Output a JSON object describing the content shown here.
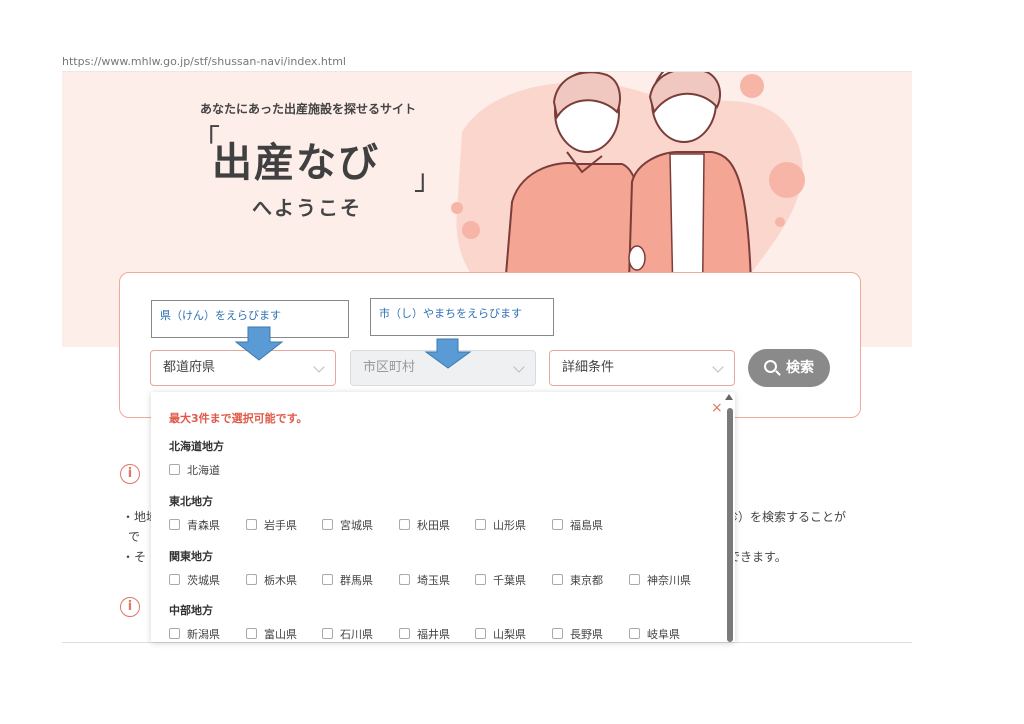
{
  "browser": {
    "url": "https://www.mhlw.go.jp/stf/shussan-navi/index.html"
  },
  "hero": {
    "tagline": "あなたにあった出産施設を探せるサイト",
    "bracket_open": "「",
    "brand": "出産なび",
    "bracket_close": "」",
    "welcome": "へようこそ"
  },
  "annotations": {
    "prefecture": "県（けん）をえらびます",
    "city": "市（し）やまちをえらびます"
  },
  "search": {
    "prefecture_placeholder": "都道府県",
    "city_placeholder": "市区町村",
    "conditions_placeholder": "詳細条件",
    "button_label": "検索"
  },
  "info": {
    "icon_glyph": "i",
    "line1_start": "・地域",
    "line1_end": "診）を検索することが",
    "line2_start": "で",
    "line2_end": "",
    "line3_start": "・そ",
    "line3_end": "できます。"
  },
  "dropdown": {
    "note": "最大3件まで選択可能です。",
    "close": "×",
    "regions": [
      {
        "name": "北海道地方",
        "prefectures": [
          "北海道"
        ]
      },
      {
        "name": "東北地方",
        "prefectures": [
          "青森県",
          "岩手県",
          "宮城県",
          "秋田県",
          "山形県",
          "福島県"
        ]
      },
      {
        "name": "関東地方",
        "prefectures": [
          "茨城県",
          "栃木県",
          "群馬県",
          "埼玉県",
          "千葉県",
          "東京都",
          "神奈川県"
        ]
      },
      {
        "name": "中部地方",
        "prefectures": [
          "新潟県",
          "富山県",
          "石川県",
          "福井県",
          "山梨県",
          "長野県",
          "岐阜県"
        ]
      }
    ]
  },
  "colors": {
    "hero_bg": "#fdeeea",
    "accent": "#e07766",
    "annotation_text": "#2e6fb6",
    "arrow": "#5b9bd5",
    "search_button": "#8a8a8a"
  }
}
